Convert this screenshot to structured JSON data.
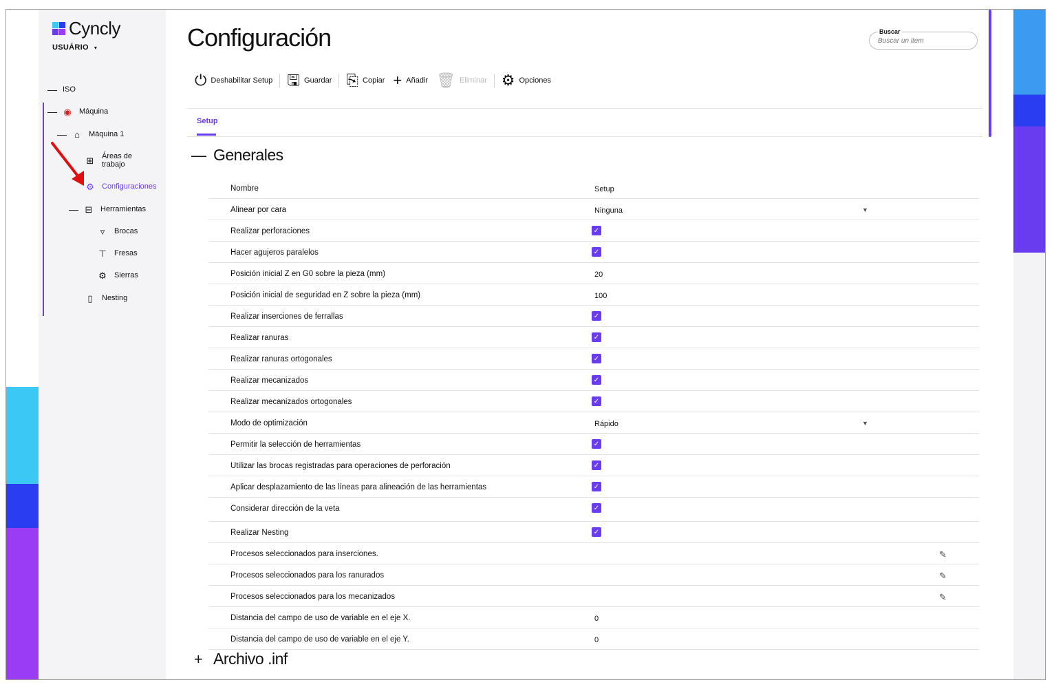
{
  "app": {
    "logo_text": "Cyncly",
    "user": "USUÁRIO"
  },
  "sidebar": {
    "items": [
      {
        "label": "ISO"
      },
      {
        "label": "Máquina"
      },
      {
        "label": "Máquina 1"
      },
      {
        "label": "Áreas de trabajo"
      },
      {
        "label": "Configuraciones"
      },
      {
        "label": "Herramientas"
      },
      {
        "label": "Brocas"
      },
      {
        "label": "Fresas"
      },
      {
        "label": "Sierras"
      },
      {
        "label": "Nesting"
      }
    ]
  },
  "page": {
    "title": "Configuración"
  },
  "search": {
    "label": "Buscar",
    "placeholder": "Buscar un item"
  },
  "toolbar": {
    "disable_label": "Deshabilitar Setup",
    "save_label": "Guardar",
    "copy_label": "Copiar",
    "add_label": "Añadir",
    "delete_label": "Eliminar",
    "options_label": "Opciones"
  },
  "tabs": [
    {
      "label": "Setup"
    }
  ],
  "sections": {
    "generales": "Generales",
    "archivo": "Archivo .inf"
  },
  "rows": [
    {
      "label": "Nombre",
      "value": "Setup"
    },
    {
      "label": "Alinear por cara",
      "value": "Ninguna"
    },
    {
      "label": "Realizar perforaciones"
    },
    {
      "label": "Hacer agujeros paralelos"
    },
    {
      "label": "Posición inicial Z en G0 sobre la pieza (mm)",
      "value": "20"
    },
    {
      "label": "Posición inicial de seguridad en Z sobre la pieza (mm)",
      "value": "100"
    },
    {
      "label": "Realizar inserciones de ferrallas"
    },
    {
      "label": "Realizar ranuras"
    },
    {
      "label": "Realizar ranuras ortogonales"
    },
    {
      "label": "Realizar mecanizados"
    },
    {
      "label": "Realizar mecanizados ortogonales"
    },
    {
      "label": "Modo de optimización",
      "value": "Rápido"
    },
    {
      "label": "Permitir la selección de herramientas"
    },
    {
      "label": "Utilizar las brocas registradas para operaciones de perforación"
    },
    {
      "label": "Aplicar desplazamiento de las líneas para alineación de las herramientas"
    },
    {
      "label": "Considerar dirección de la veta"
    },
    {
      "label": "Realizar Nesting"
    },
    {
      "label": "Procesos seleccionados para inserciones."
    },
    {
      "label": "Procesos seleccionados para los ranurados"
    },
    {
      "label": "Procesos seleccionados para los mecanizados"
    },
    {
      "label": "Distancia del campo de uso de variable en el eje X.",
      "value": "0"
    },
    {
      "label": "Distancia del campo de uso de variable en el eje Y.",
      "value": "0"
    }
  ]
}
